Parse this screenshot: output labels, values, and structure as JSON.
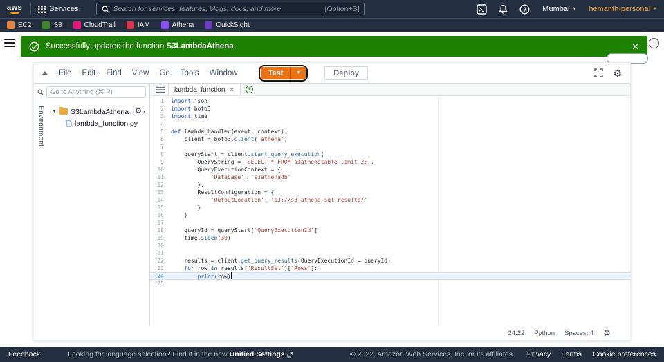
{
  "topnav": {
    "logo_text": "aws",
    "services_label": "Services",
    "search_placeholder": "Search for services, features, blogs, docs, and more",
    "search_shortcut": "[Option+S]",
    "region": "Mumbai",
    "account": "hemanth-personal",
    "account_color": "#eda23b"
  },
  "favorites": [
    {
      "label": "EC2",
      "color": "#e8823d"
    },
    {
      "label": "S3",
      "color": "#3f8624"
    },
    {
      "label": "CloudTrail",
      "color": "#e7157b"
    },
    {
      "label": "IAM",
      "color": "#dd344c"
    },
    {
      "label": "Athena",
      "color": "#8c4fff"
    },
    {
      "label": "QuickSight",
      "color": "#6b3fc4"
    }
  ],
  "flash": {
    "prefix": "Successfully updated the function ",
    "function_name": "S3LambdaAthena",
    "suffix": ".",
    "color": "#1d8102"
  },
  "menubar": {
    "items": [
      "File",
      "Edit",
      "Find",
      "View",
      "Go",
      "Tools",
      "Window"
    ],
    "test_label": "Test",
    "deploy_label": "Deploy",
    "accent_color": "#ec7211"
  },
  "sidebar": {
    "goto_placeholder": "Go to Anything (⌘ P)",
    "environment_label": "Environment",
    "folder_name": "S3LambdaAthena",
    "file_name": "lambda_function.py"
  },
  "editor": {
    "tab_name": "lambda_function",
    "status": {
      "cursor": "24:22",
      "language": "Python",
      "spaces": "Spaces: 4"
    },
    "lines": [
      {
        "n": "1",
        "t": [
          [
            "kw",
            "import"
          ],
          [
            "p",
            " json"
          ]
        ]
      },
      {
        "n": "2",
        "t": [
          [
            "kw",
            "import"
          ],
          [
            "p",
            " boto3"
          ]
        ]
      },
      {
        "n": "3",
        "t": [
          [
            "kw",
            "import"
          ],
          [
            "p",
            " time"
          ]
        ]
      },
      {
        "n": "4",
        "t": []
      },
      {
        "n": "5",
        "t": [
          [
            "kw",
            "def"
          ],
          [
            "p",
            " lambda_handler(event, context):"
          ]
        ]
      },
      {
        "n": "6",
        "t": [
          [
            "p",
            "    client = boto3."
          ],
          [
            "f",
            "client"
          ],
          [
            "p",
            "("
          ],
          [
            "s",
            "'athena'"
          ],
          [
            "p",
            ")"
          ]
        ]
      },
      {
        "n": "7",
        "t": []
      },
      {
        "n": "8",
        "t": [
          [
            "p",
            "    queryStart = client."
          ],
          [
            "f",
            "start_query_execution"
          ],
          [
            "p",
            "("
          ]
        ]
      },
      {
        "n": "9",
        "t": [
          [
            "p",
            "        QueryString = "
          ],
          [
            "s",
            "'SELECT * FROM s3athenatable limit 2;'"
          ],
          [
            "p",
            ","
          ]
        ]
      },
      {
        "n": "10",
        "t": [
          [
            "p",
            "        QueryExecutionContext = {"
          ]
        ]
      },
      {
        "n": "11",
        "t": [
          [
            "p",
            "            "
          ],
          [
            "s",
            "'Database'"
          ],
          [
            "p",
            ": "
          ],
          [
            "s",
            "'s3athenadb'"
          ]
        ]
      },
      {
        "n": "12",
        "t": [
          [
            "p",
            "        },"
          ]
        ]
      },
      {
        "n": "13",
        "t": [
          [
            "p",
            "        ResultConfiguration = {"
          ]
        ]
      },
      {
        "n": "14",
        "t": [
          [
            "p",
            "            "
          ],
          [
            "s",
            "'OutputLocation'"
          ],
          [
            "p",
            ": "
          ],
          [
            "s",
            "'s3://s3-athena-sql-results/'"
          ]
        ]
      },
      {
        "n": "15",
        "t": [
          [
            "p",
            "        }"
          ]
        ]
      },
      {
        "n": "16",
        "t": [
          [
            "p",
            "    )"
          ]
        ]
      },
      {
        "n": "17",
        "t": []
      },
      {
        "n": "18",
        "t": [
          [
            "p",
            "    queryId = queryStart["
          ],
          [
            "s",
            "'QueryExecutionId'"
          ],
          [
            "p",
            "]"
          ]
        ]
      },
      {
        "n": "19",
        "t": [
          [
            "p",
            "    time."
          ],
          [
            "f",
            "sleep"
          ],
          [
            "p",
            "("
          ],
          [
            "num",
            "30"
          ],
          [
            "p",
            ")"
          ]
        ]
      },
      {
        "n": "20",
        "t": []
      },
      {
        "n": "21",
        "t": []
      },
      {
        "n": "22",
        "t": [
          [
            "p",
            "    results = client."
          ],
          [
            "f",
            "get_query_results"
          ],
          [
            "p",
            "(QueryExecutionId = queryId)"
          ]
        ]
      },
      {
        "n": "23",
        "t": [
          [
            "p",
            "    "
          ],
          [
            "kw",
            "for"
          ],
          [
            "p",
            " row "
          ],
          [
            "kw",
            "in"
          ],
          [
            "p",
            " results["
          ],
          [
            "s",
            "'ResultSet'"
          ],
          [
            "p",
            "]["
          ],
          [
            "s",
            "'Rows'"
          ],
          [
            "p",
            "]:"
          ]
        ]
      },
      {
        "n": "24",
        "t": [
          [
            "p",
            "        "
          ],
          [
            "kw",
            "print"
          ],
          [
            "p",
            "(row)"
          ]
        ],
        "active": true,
        "caret": true
      },
      {
        "n": "25",
        "t": []
      }
    ]
  },
  "footer": {
    "feedback": "Feedback",
    "language_prefix": "Looking for language selection? Find it in the new ",
    "language_link": "Unified Settings",
    "copyright": "© 2022, Amazon Web Services, Inc. or its affiliates.",
    "links": [
      "Privacy",
      "Terms",
      "Cookie preferences"
    ]
  }
}
